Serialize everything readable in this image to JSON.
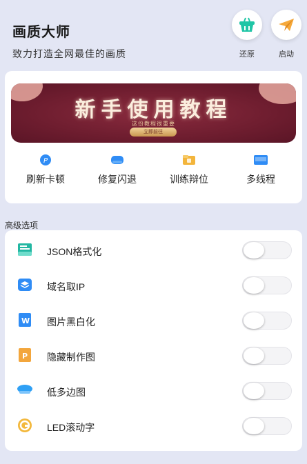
{
  "header": {
    "title": "画质大师",
    "subtitle": "致力打造全网最佳的画质",
    "restore_label": "还原",
    "launch_label": "启动"
  },
  "banner": {
    "title": "新手使用教程",
    "subtitle": "这份教程很重要",
    "button_label": "立即前往"
  },
  "quick_actions": [
    {
      "label": "刷新卡顿",
      "icon": "p-badge-icon",
      "color": "#2f8cf5"
    },
    {
      "label": "修复闪退",
      "icon": "cloud-icon",
      "color": "#2f8cf5"
    },
    {
      "label": "训练辩位",
      "icon": "folder-icon",
      "color": "#f3b53c"
    },
    {
      "label": "多线程",
      "icon": "ocr-icon",
      "color": "#2f8cf5"
    }
  ],
  "section": {
    "title": "高级选项"
  },
  "options": [
    {
      "label": "JSON格式化",
      "icon": "inbox-icon",
      "color": "#22b7a2",
      "enabled": false
    },
    {
      "label": "域名取IP",
      "icon": "layers-icon",
      "color": "#2f8cf5",
      "enabled": false
    },
    {
      "label": "图片黑白化",
      "icon": "word-doc-icon",
      "color": "#2f8cf5",
      "enabled": false
    },
    {
      "label": "隐藏制作图",
      "icon": "ppt-doc-icon",
      "color": "#f3a63c",
      "enabled": false
    },
    {
      "label": "低多边图",
      "icon": "cloud-icon",
      "color": "#2fa0f5",
      "enabled": false
    },
    {
      "label": "LED滚动字",
      "icon": "g-coin-icon",
      "color": "#f3b83c",
      "enabled": false
    }
  ],
  "colors": {
    "accent": "#2f8cf5",
    "background": "#e3e6f4",
    "banner": "#6e1d2f"
  }
}
